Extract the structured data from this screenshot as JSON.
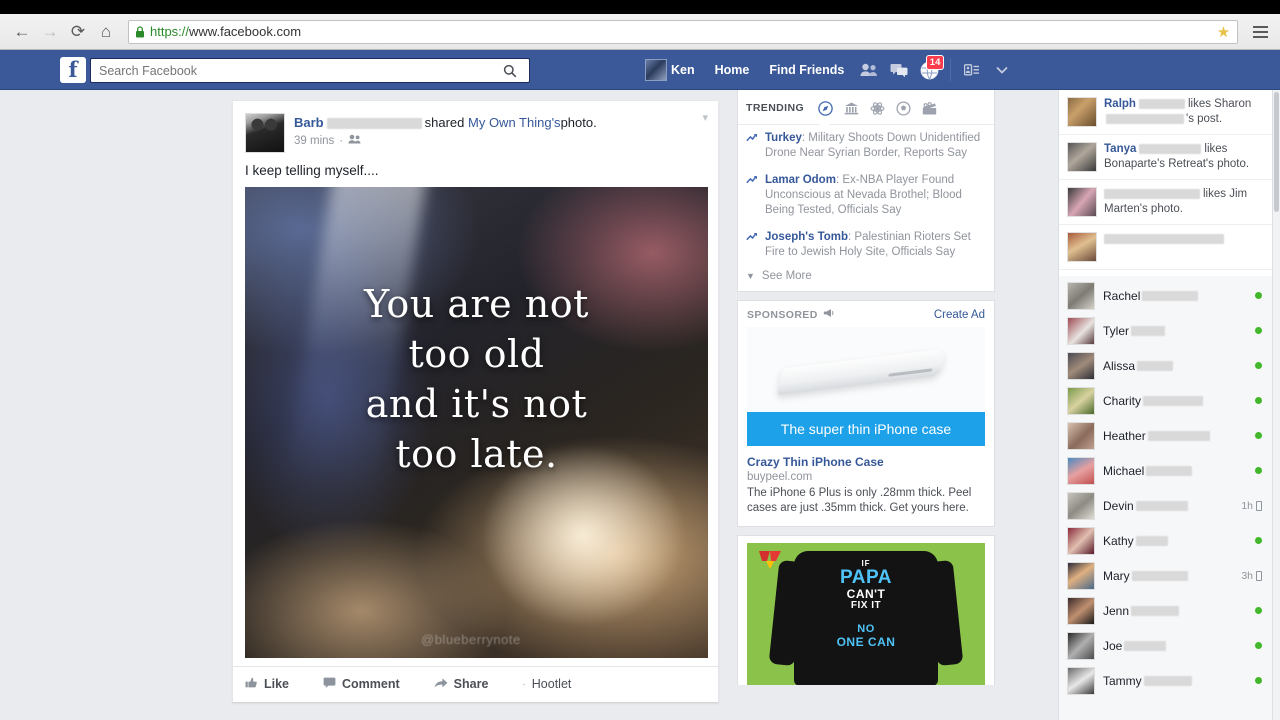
{
  "browser": {
    "url_scheme": "https://",
    "url_host": "www.facebook.com",
    "back_icon": "back-arrow-icon",
    "forward_icon": "forward-arrow-icon",
    "reload_icon": "reload-icon",
    "home_icon": "home-icon",
    "lock_icon": "lock-icon",
    "star_icon": "bookmark-star-icon",
    "menu_icon": "hamburger-menu-icon"
  },
  "fbbar": {
    "logo": "f",
    "search_placeholder": "Search Facebook",
    "search_value": "",
    "search_icon": "search-icon",
    "profile_name": "Ken",
    "home_label": "Home",
    "find_friends_label": "Find Friends",
    "friend_requests_icon": "friend-requests-icon",
    "messages_icon": "messages-icon",
    "notifications_icon": "globe-notifications-icon",
    "notifications_count": "14",
    "privacy_icon": "privacy-shortcuts-icon",
    "account_caret_icon": "chevron-down-icon",
    "brand_color": "#3b5998",
    "badge_color": "#fa3c4c"
  },
  "post": {
    "author": "Barb",
    "author_blur_width": 95,
    "shared_text": "shared",
    "shared_target": "My Own Thing's",
    "photo_word": "photo.",
    "timestamp": "39 mins",
    "audience_icon": "friends-audience-icon",
    "options_icon": "chevron-down-icon",
    "avatar_icon": "dog-avatar",
    "body_text": "I keep telling myself....",
    "quote_lines": [
      "You are not",
      "too old",
      "and it's not",
      "too late."
    ],
    "watermark": "@blueberrynote",
    "actions": [
      {
        "label": "Like",
        "icon": "thumbs-up-icon"
      },
      {
        "label": "Comment",
        "icon": "comment-bubble-icon"
      },
      {
        "label": "Share",
        "icon": "share-arrow-icon"
      },
      {
        "label": "Hootlet",
        "icon": "hootlet-icon"
      }
    ]
  },
  "trending": {
    "label": "TRENDING",
    "tabs": [
      {
        "name": "all-topics",
        "icon": "compass-icon",
        "active": true
      },
      {
        "name": "politics",
        "icon": "government-building-icon",
        "active": false
      },
      {
        "name": "science",
        "icon": "atom-icon",
        "active": false
      },
      {
        "name": "sports",
        "icon": "soccer-ball-icon",
        "active": false
      },
      {
        "name": "entertainment",
        "icon": "film-clapper-icon",
        "active": false
      }
    ],
    "items": [
      {
        "topic": "Turkey",
        "desc": ": Military Shoots Down Unidentified Drone Near Syrian Border, Reports Say"
      },
      {
        "topic": "Lamar Odom",
        "desc": ": Ex-NBA Player Found Unconscious at Nevada Brothel; Blood Being Tested, Officials Say"
      },
      {
        "topic": "Joseph's Tomb",
        "desc": ": Palestinian Rioters Set Fire to Jewish Holy Site, Officials Say"
      }
    ],
    "see_more": "See More",
    "see_more_icon": "caret-down-icon"
  },
  "sponsored": {
    "label": "SPONSORED",
    "label_icon": "megaphone-icon",
    "create_ad": "Create Ad",
    "ad1": {
      "image_icon": "white-iphone-case-photo",
      "banner_text": "The super thin iPhone case",
      "banner_color": "#1da1e8",
      "title": "Crazy Thin iPhone Case",
      "url": "buypeel.com",
      "description": "The iPhone 6 Plus is only .28mm thick. Peel cases are just .35mm thick. Get yours here."
    },
    "ad2": {
      "image_icon": "black-sweatshirt-photo",
      "bg_color": "#8bc34a",
      "shirt_lines": [
        "IF",
        "PAPA",
        "CAN'T",
        "FIX IT",
        "NO",
        "ONE CAN"
      ],
      "bow_icon": "red-bow-icon"
    }
  },
  "ticker": {
    "items": [
      {
        "name": "Ralph",
        "name_blur": 46,
        "mid": "likes Sharon",
        "tail_blur": 78,
        "tail": "'s post.",
        "thumb": "tt1"
      },
      {
        "name": "Tanya",
        "name_blur": 62,
        "mid": "likes",
        "tail": "Bonaparte's Retreat's photo.",
        "thumb": "tt2"
      },
      {
        "name": "",
        "name_blur": 96,
        "mid": "likes Jim",
        "tail": "Marten's photo.",
        "thumb": "tt3"
      },
      {
        "name": "",
        "name_blur": 120,
        "mid": "",
        "tail": "",
        "thumb": "tt4"
      }
    ]
  },
  "chat": {
    "contacts": [
      {
        "name": "Rachel",
        "blur": 56,
        "status": "online",
        "time": "",
        "thumb": "ct1"
      },
      {
        "name": "Tyler",
        "blur": 34,
        "status": "online",
        "time": "",
        "thumb": "ct2"
      },
      {
        "name": "Alissa",
        "blur": 36,
        "status": "online",
        "time": "",
        "thumb": "ct3"
      },
      {
        "name": "Charity",
        "blur": 60,
        "status": "online",
        "time": "",
        "thumb": "ct4"
      },
      {
        "name": "Heather",
        "blur": 62,
        "status": "online",
        "time": "",
        "thumb": "ct5"
      },
      {
        "name": "Michael",
        "blur": 46,
        "status": "online",
        "time": "",
        "thumb": "ct6"
      },
      {
        "name": "Devin",
        "blur": 52,
        "status": "mobile",
        "time": "1h",
        "thumb": "ct7"
      },
      {
        "name": "Kathy",
        "blur": 32,
        "status": "online",
        "time": "",
        "thumb": "ct8"
      },
      {
        "name": "Mary",
        "blur": 56,
        "status": "mobile",
        "time": "3h",
        "thumb": "ct9"
      },
      {
        "name": "Jenn",
        "blur": 48,
        "status": "online",
        "time": "",
        "thumb": "ct10"
      },
      {
        "name": "Joe",
        "blur": 42,
        "status": "online",
        "time": "",
        "thumb": "ct11"
      },
      {
        "name": "Tammy",
        "blur": 48,
        "status": "online",
        "time": "",
        "thumb": "ct12"
      }
    ]
  }
}
